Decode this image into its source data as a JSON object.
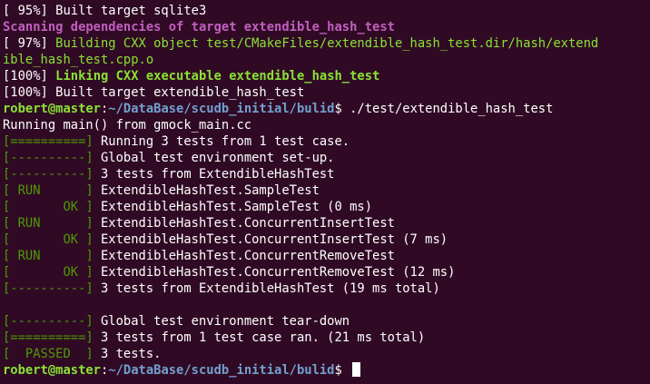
{
  "colors": {
    "background": "#300a24",
    "text": "#ffffff",
    "green": "#8ae234",
    "gtest_green": "#4e9a06",
    "magenta": "#c15fbf",
    "prompt_path_blue": "#729fcf"
  },
  "lines": [
    {
      "segments": [
        {
          "text": "[ 95%] Built target sqlite3",
          "style": "w"
        }
      ]
    },
    {
      "segments": [
        {
          "text": "Scanning dependencies of target extendible_hash_test",
          "style": "bm"
        }
      ]
    },
    {
      "segments": [
        {
          "text": "[ 97%] ",
          "style": "w"
        },
        {
          "text": "Building CXX object test/CMakeFiles/extendible_hash_test.dir/hash/extend",
          "style": "g"
        }
      ]
    },
    {
      "segments": [
        {
          "text": "ible_hash_test.cpp.o",
          "style": "g"
        }
      ]
    },
    {
      "segments": [
        {
          "text": "[100%] ",
          "style": "w"
        },
        {
          "text": "Linking CXX executable extendible_hash_test",
          "style": "bg"
        }
      ]
    },
    {
      "segments": [
        {
          "text": "[100%] Built target extendible_hash_test",
          "style": "w"
        }
      ]
    },
    {
      "segments": [
        {
          "text": "robert@master",
          "style": "pu"
        },
        {
          "text": ":",
          "style": "w"
        },
        {
          "text": "~/DataBase/scudb_initial/bulid",
          "style": "pp"
        },
        {
          "text": "$ ./test/extendible_hash_test",
          "style": "w"
        }
      ]
    },
    {
      "segments": [
        {
          "text": "Running main() from gmock_main.cc",
          "style": "w"
        }
      ]
    },
    {
      "segments": [
        {
          "text": "[==========]",
          "style": "gt"
        },
        {
          "text": " Running 3 tests from 1 test case.",
          "style": "w"
        }
      ]
    },
    {
      "segments": [
        {
          "text": "[----------]",
          "style": "gt"
        },
        {
          "text": " Global test environment set-up.",
          "style": "w"
        }
      ]
    },
    {
      "segments": [
        {
          "text": "[----------]",
          "style": "gt"
        },
        {
          "text": " 3 tests from ExtendibleHashTest",
          "style": "w"
        }
      ]
    },
    {
      "segments": [
        {
          "text": "[ RUN      ]",
          "style": "gt"
        },
        {
          "text": " ExtendibleHashTest.SampleTest",
          "style": "w"
        }
      ]
    },
    {
      "segments": [
        {
          "text": "[       OK ]",
          "style": "gt"
        },
        {
          "text": " ExtendibleHashTest.SampleTest (0 ms)",
          "style": "w"
        }
      ]
    },
    {
      "segments": [
        {
          "text": "[ RUN      ]",
          "style": "gt"
        },
        {
          "text": " ExtendibleHashTest.ConcurrentInsertTest",
          "style": "w"
        }
      ]
    },
    {
      "segments": [
        {
          "text": "[       OK ]",
          "style": "gt"
        },
        {
          "text": " ExtendibleHashTest.ConcurrentInsertTest (7 ms)",
          "style": "w"
        }
      ]
    },
    {
      "segments": [
        {
          "text": "[ RUN      ]",
          "style": "gt"
        },
        {
          "text": " ExtendibleHashTest.ConcurrentRemoveTest",
          "style": "w"
        }
      ]
    },
    {
      "segments": [
        {
          "text": "[       OK ]",
          "style": "gt"
        },
        {
          "text": " ExtendibleHashTest.ConcurrentRemoveTest (12 ms)",
          "style": "w"
        }
      ]
    },
    {
      "segments": [
        {
          "text": "[----------]",
          "style": "gt"
        },
        {
          "text": " 3 tests from ExtendibleHashTest (19 ms total)",
          "style": "w"
        }
      ]
    },
    {
      "segments": []
    },
    {
      "segments": [
        {
          "text": "[----------]",
          "style": "gt"
        },
        {
          "text": " Global test environment tear-down",
          "style": "w"
        }
      ]
    },
    {
      "segments": [
        {
          "text": "[==========]",
          "style": "gt"
        },
        {
          "text": " 3 tests from 1 test case ran. (21 ms total)",
          "style": "w"
        }
      ]
    },
    {
      "segments": [
        {
          "text": "[  PASSED  ]",
          "style": "gt"
        },
        {
          "text": " 3 tests.",
          "style": "w"
        }
      ]
    },
    {
      "segments": [
        {
          "text": "robert@master",
          "style": "pu"
        },
        {
          "text": ":",
          "style": "w"
        },
        {
          "text": "~/DataBase/scudb_initial/bulid",
          "style": "pp"
        },
        {
          "text": "$ ",
          "style": "w"
        }
      ],
      "cursor": true
    }
  ]
}
